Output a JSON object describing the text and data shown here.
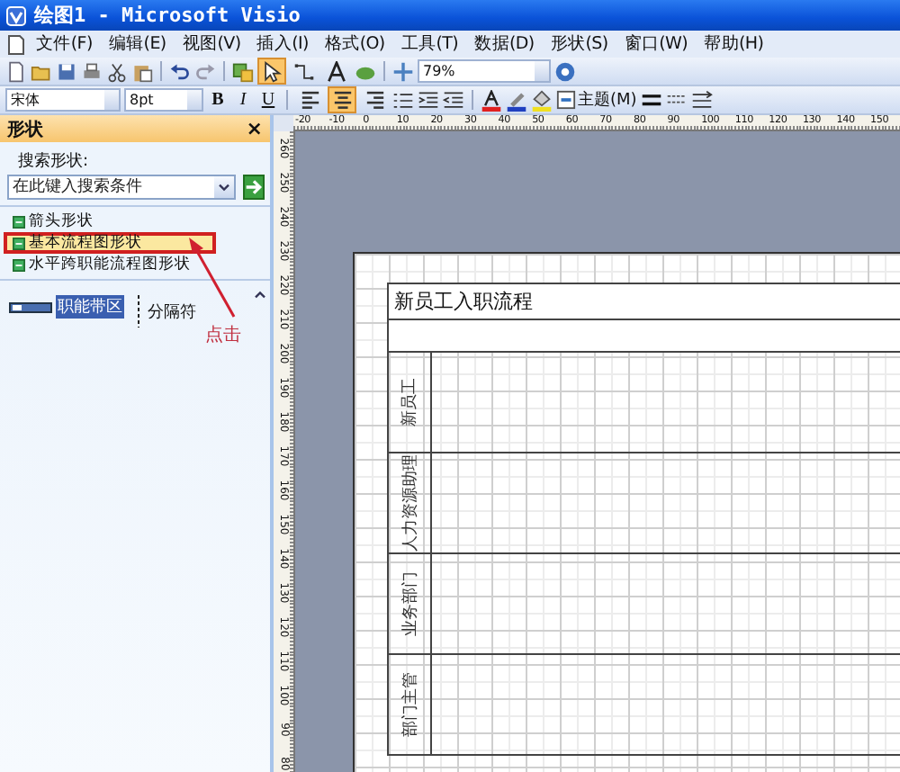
{
  "window": {
    "title": "绘图1 - Microsoft Visio"
  },
  "menu": [
    "文件(F)",
    "编辑(E)",
    "视图(V)",
    "插入(I)",
    "格式(O)",
    "工具(T)",
    "数据(D)",
    "形状(S)",
    "窗口(W)",
    "帮助(H)"
  ],
  "toolbar": {
    "tools": [
      {
        "selected": true
      },
      {
        "selected": false
      },
      {
        "selected": false
      }
    ],
    "zoom": "79%"
  },
  "format_bar": {
    "font": "宋体",
    "size": "8pt",
    "bold": "B",
    "italic": "I",
    "underline": "U",
    "align": [
      {
        "selected": false
      },
      {
        "selected": true
      },
      {
        "selected": false
      }
    ],
    "theme": "主题(M)"
  },
  "shapes_panel": {
    "title": "形状",
    "close": "×",
    "search_label": "搜索形状:",
    "search_placeholder": "在此键入搜索条件",
    "stencils": [
      {
        "label": "箭头形状",
        "selected": false
      },
      {
        "label": "基本流程图形状",
        "selected": true
      },
      {
        "label": "水平跨职能流程图形状",
        "selected": false
      }
    ],
    "masters": [
      {
        "label": "职能带区",
        "selected": true
      },
      {
        "label": "分隔符",
        "selected": false
      }
    ],
    "annotation": "点击"
  },
  "ruler_h": [
    "-20",
    "-10",
    "0",
    "10",
    "20",
    "30",
    "40",
    "50",
    "60",
    "70",
    "80",
    "90",
    "100",
    "110",
    "120",
    "130",
    "140",
    "150"
  ],
  "ruler_v": [
    "260",
    "250",
    "240",
    "230",
    "220",
    "210",
    "200",
    "190",
    "180",
    "170",
    "160",
    "150",
    "140",
    "130",
    "120",
    "110",
    "100",
    "90",
    "80"
  ],
  "diagram": {
    "title": "新员工入职流程",
    "lanes": [
      "新员工",
      "人力资源助理",
      "业务部门",
      "部门主管"
    ]
  }
}
